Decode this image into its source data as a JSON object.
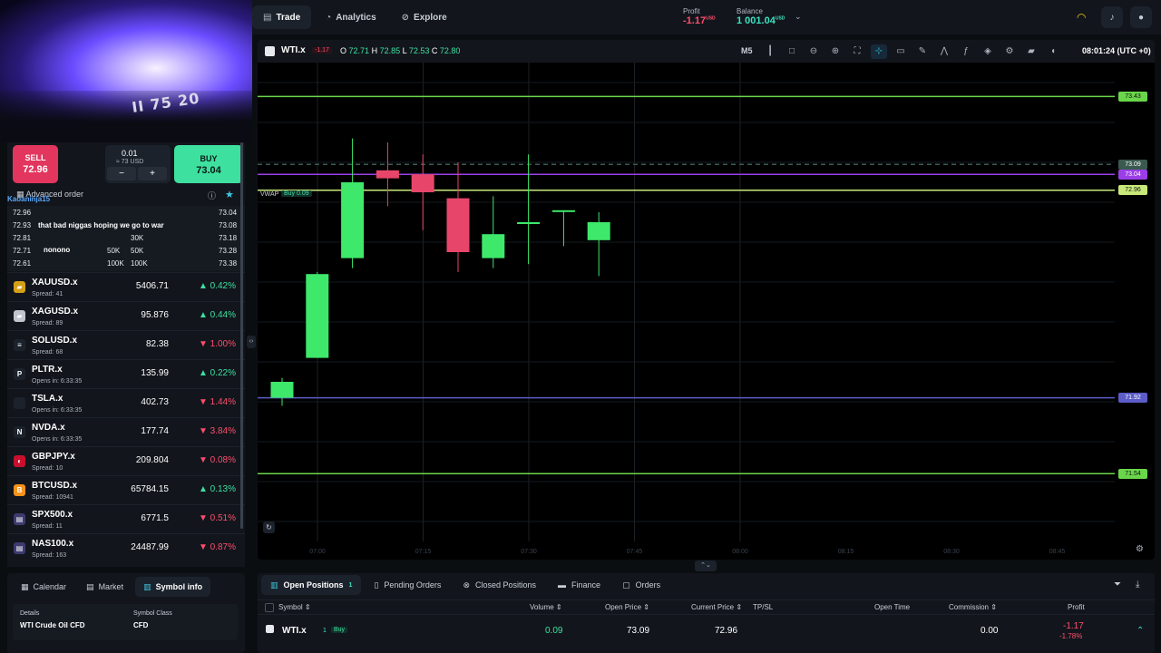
{
  "topbar": {
    "tabs": [
      {
        "label": "Trade",
        "icon": "trade-icon"
      },
      {
        "label": "Analytics",
        "icon": "analytics-icon"
      },
      {
        "label": "Explore",
        "icon": "explore-icon"
      }
    ],
    "profit_label": "Profit",
    "profit_value": "-1.17",
    "profit_currency": "USD",
    "balance_label": "Balance",
    "balance_value": "1 001.04",
    "balance_currency": "USD"
  },
  "webcam": {
    "sign_text": "II 75 20"
  },
  "trade_box": {
    "sell_label": "SELL",
    "sell_price": "72.96",
    "lot_value": "0.01",
    "lot_usd": "≈ 73 USD",
    "minus": "−",
    "plus": "+",
    "buy_label": "BUY",
    "buy_price": "73.04"
  },
  "advanced": {
    "label": "Advanced order"
  },
  "order_book": [
    {
      "bid": "72.96",
      "bid_vol": "",
      "ask_vol": "",
      "ask": "73.04"
    },
    {
      "bid": "72.93",
      "bid_vol": "",
      "ask_vol": "",
      "ask": "73.08"
    },
    {
      "bid": "72.81",
      "bid_vol": "",
      "ask_vol": "30K",
      "ask": "73.18"
    },
    {
      "bid": "72.71",
      "bid_vol": "50K",
      "ask_vol": "50K",
      "ask": "73.28"
    },
    {
      "bid": "72.61",
      "bid_vol": "100K",
      "ask_vol": "100K",
      "ask": "73.38"
    }
  ],
  "chat": [
    {
      "name": "Kaoaninja15",
      "msg": ""
    },
    {
      "name": "Kaoaninja15",
      "msg": "that bad niggas hoping we go to war"
    },
    {
      "name": "Kaoaninja15",
      "msg": "nonono"
    }
  ],
  "symbols": [
    {
      "name": "XAUUSD.x",
      "sub": "Spread: 41",
      "price": "5406.71",
      "change": "0.42%",
      "dir": "up",
      "icon": "gold-icon",
      "color": "#d4a017",
      "glyph": "▰"
    },
    {
      "name": "XAGUSD.x",
      "sub": "Spread: 89",
      "price": "95.876",
      "change": "0.44%",
      "dir": "up",
      "icon": "silver-icon",
      "color": "#c0c4cc",
      "glyph": "▰"
    },
    {
      "name": "SOLUSD.x",
      "sub": "Spread: 68",
      "price": "82.38",
      "change": "1.00%",
      "dir": "down",
      "icon": "solana-icon",
      "color": "#1c222b",
      "glyph": "≡"
    },
    {
      "name": "PLTR.x",
      "sub": "Opens in: 6:33:35",
      "price": "135.99",
      "change": "0.22%",
      "dir": "up",
      "icon": "palantir-icon",
      "color": "#1c222b",
      "glyph": "P"
    },
    {
      "name": "TSLA.x",
      "sub": "Opens in: 6:33:35",
      "price": "402.73",
      "change": "1.44%",
      "dir": "down",
      "icon": "tesla-icon",
      "color": "#1c222b",
      "glyph": ""
    },
    {
      "name": "NVDA.x",
      "sub": "Opens in: 6:33:35",
      "price": "177.74",
      "change": "3.84%",
      "dir": "down",
      "icon": "nvidia-icon",
      "color": "#1c222b",
      "glyph": "N"
    },
    {
      "name": "GBPJPY.x",
      "sub": "Spread: 10",
      "price": "209.804",
      "change": "0.08%",
      "dir": "down",
      "icon": "gbp-flag-icon",
      "color": "#c8102e",
      "glyph": "◐"
    },
    {
      "name": "BTCUSD.x",
      "sub": "Spread: 10941",
      "price": "65784.15",
      "change": "0.13%",
      "dir": "up",
      "icon": "bitcoin-icon",
      "color": "#f7931a",
      "glyph": "B"
    },
    {
      "name": "SPX500.x",
      "sub": "Spread: 11",
      "price": "6771.5",
      "change": "0.51%",
      "dir": "down",
      "icon": "us-flag-icon",
      "color": "#3c3b6e",
      "glyph": "▤"
    },
    {
      "name": "NAS100.x",
      "sub": "Spread: 163",
      "price": "24487.99",
      "change": "0.87%",
      "dir": "down",
      "icon": "us-flag-icon",
      "color": "#3c3b6e",
      "glyph": "▤"
    }
  ],
  "chart_header": {
    "symbol": "WTI.x",
    "change": "-1.17",
    "o_label": "O",
    "o": "72.71",
    "h_label": "H",
    "h": "72.85",
    "l_label": "L",
    "l": "72.53",
    "c_label": "C",
    "c": "72.80",
    "timeframe": "M5",
    "time": "08:01:24 (UTC +0)",
    "tools": [
      "candles-icon",
      "rectangle-icon",
      "zoom-out-icon",
      "zoom-in-icon",
      "fullscreen-icon",
      "crosshair-icon",
      "ruler-icon",
      "pencil-icon",
      "indicator-icon",
      "function-icon",
      "layers-icon",
      "settings-icon",
      "tradingview-icon"
    ]
  },
  "chart_overlay": {
    "vwap_label": "VWAP",
    "vwap_order": "Buy 0.09"
  },
  "chart_data": {
    "type": "candlestick",
    "title": "",
    "ylim": [
      71.2,
      73.6
    ],
    "candles": [
      {
        "o": 71.92,
        "h": 72.02,
        "l": 71.88,
        "c": 72.0
      },
      {
        "o": 72.12,
        "h": 72.55,
        "l": 72.12,
        "c": 72.54
      },
      {
        "o": 72.62,
        "h": 73.22,
        "l": 72.57,
        "c": 73.0
      },
      {
        "o": 73.06,
        "h": 73.2,
        "l": 72.88,
        "c": 73.02
      },
      {
        "o": 73.04,
        "h": 73.14,
        "l": 72.76,
        "c": 72.95
      },
      {
        "o": 72.92,
        "h": 73.1,
        "l": 72.55,
        "c": 72.65
      },
      {
        "o": 72.62,
        "h": 72.93,
        "l": 72.57,
        "c": 72.74
      },
      {
        "o": 72.8,
        "h": 73.14,
        "l": 72.59,
        "c": 72.8
      },
      {
        "o": 72.86,
        "h": 72.86,
        "l": 72.68,
        "c": 72.86
      },
      {
        "o": 72.71,
        "h": 72.85,
        "l": 72.53,
        "c": 72.8
      }
    ],
    "x_labels": [
      "07:00",
      "07:15",
      "07:30",
      "07:45",
      "08:00",
      "08:15",
      "08:30",
      "08:45"
    ],
    "levels": [
      {
        "value": 73.43,
        "color": "#6ad64a",
        "label": "73.43"
      },
      {
        "value": 73.09,
        "color": "#3a5a50",
        "label": "73.09",
        "dash": true
      },
      {
        "value": 73.04,
        "color": "#9b3ee8",
        "label": "73.04"
      },
      {
        "value": 72.96,
        "color": "#c8e87a",
        "label": "72.96"
      },
      {
        "value": 71.92,
        "color": "#5c5cc8",
        "label": "71.92"
      },
      {
        "value": 71.54,
        "color": "#6ad64a",
        "label": "71.54"
      }
    ]
  },
  "bottom_left": {
    "tabs": [
      {
        "label": "Calendar",
        "icon": "calendar-icon"
      },
      {
        "label": "Market",
        "icon": "market-icon"
      },
      {
        "label": "Symbol info",
        "icon": "info-chart-icon"
      }
    ],
    "details_key": "Details",
    "details_val": "WTI Crude Oil CFD",
    "class_key": "Symbol Class",
    "class_val": "CFD"
  },
  "bottom_right": {
    "tabs": [
      {
        "label": "Open Positions",
        "icon": "positions-icon",
        "count": "1"
      },
      {
        "label": "Pending Orders",
        "icon": "pending-icon",
        "count": ""
      },
      {
        "label": "Closed Positions",
        "icon": "closed-icon",
        "count": ""
      },
      {
        "label": "Finance",
        "icon": "finance-icon",
        "count": ""
      },
      {
        "label": "Orders",
        "icon": "orders-icon",
        "count": ""
      }
    ],
    "headers": [
      "Symbol",
      "Volume",
      "Open Price",
      "Current Price",
      "TP/SL",
      "Open Time",
      "Commission",
      "Profit"
    ],
    "position": {
      "symbol": "WTI.x",
      "qty": "1",
      "side": "Buy",
      "volume": "0.09",
      "open_price": "73.09",
      "current_price": "72.96",
      "commission": "0.00",
      "profit": "-1.17",
      "profit_pct": "-1.78%"
    }
  }
}
